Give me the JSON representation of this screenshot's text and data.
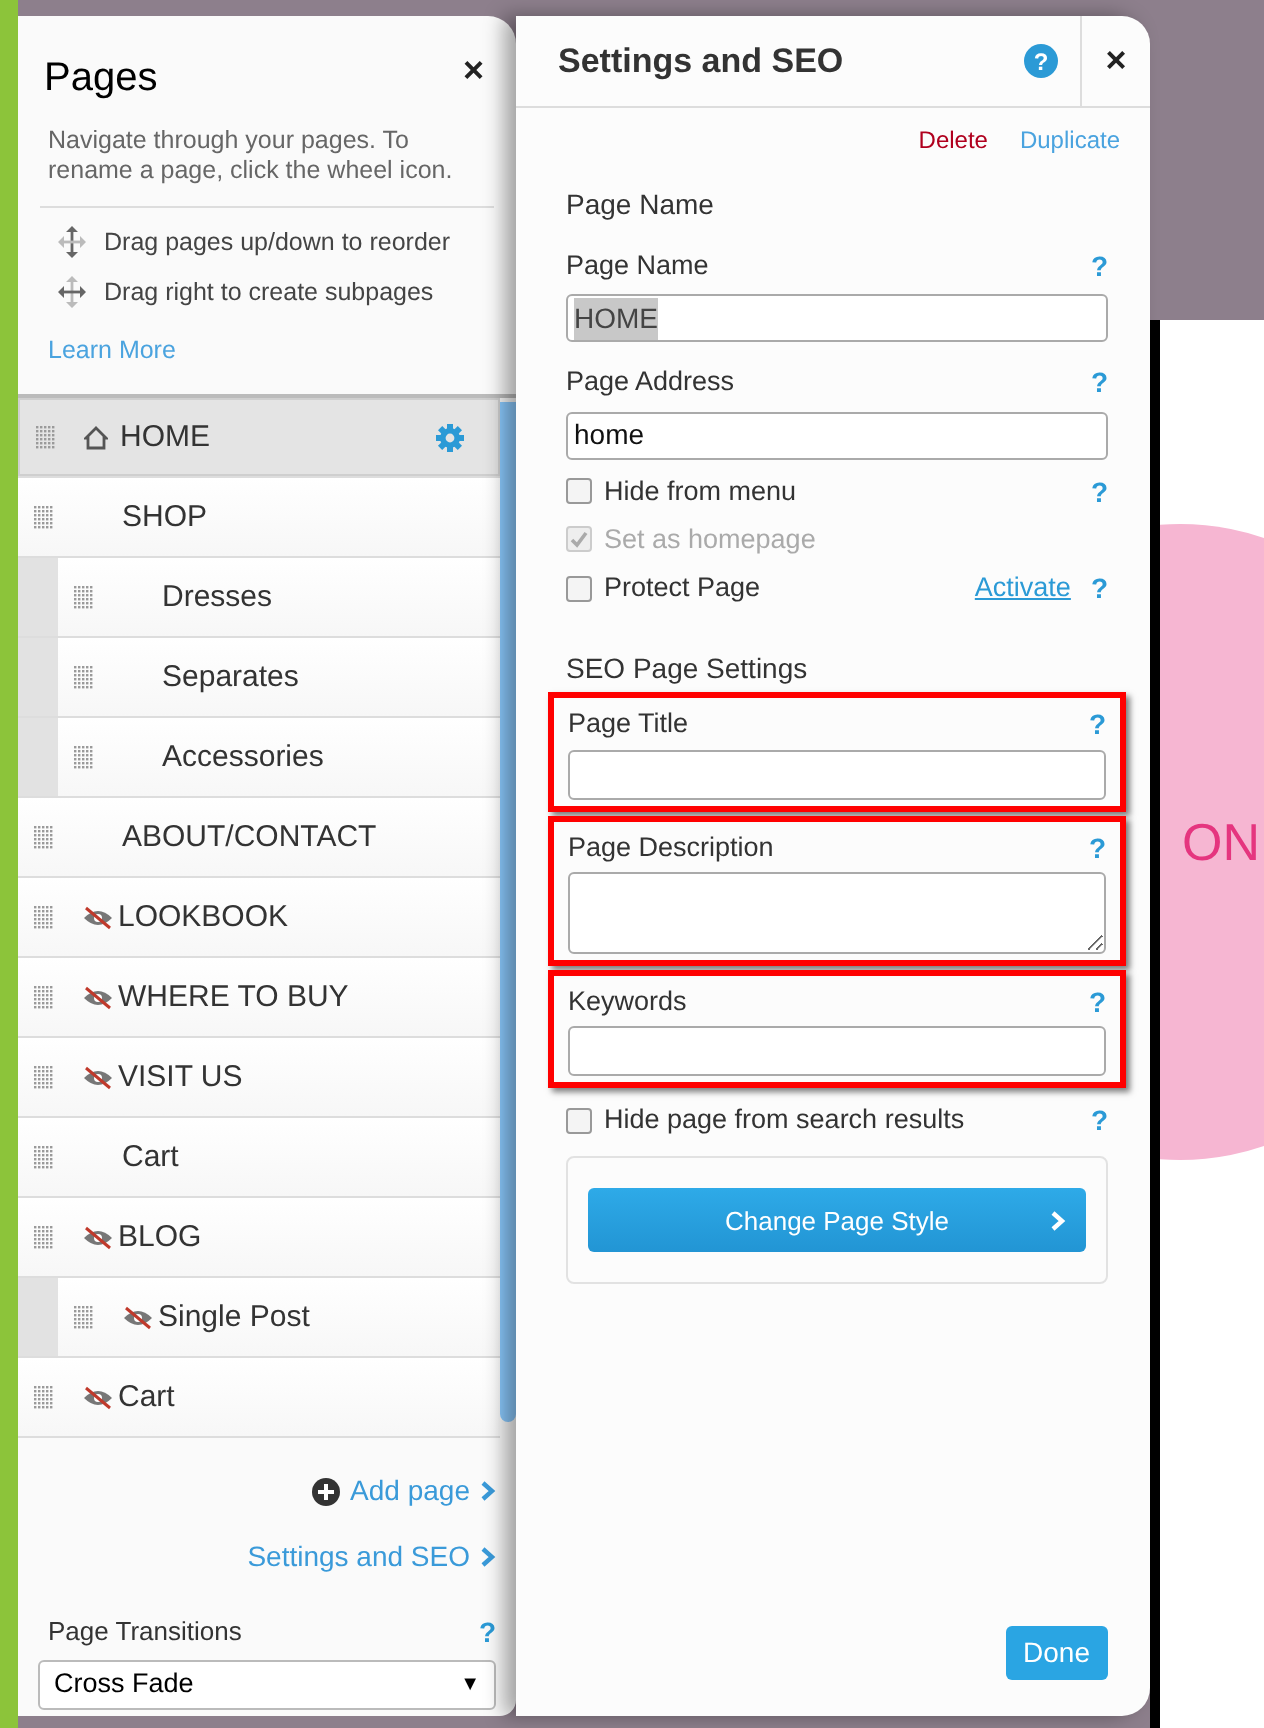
{
  "pages_panel": {
    "title": "Pages",
    "close": "×",
    "description": "Navigate through your pages. To rename a page, click the wheel icon.",
    "tips": [
      {
        "kind": "vertical",
        "text": "Drag pages up/down to reorder"
      },
      {
        "kind": "horizontal",
        "text": "Drag right to create subpages"
      }
    ],
    "learn_more": "Learn More",
    "pages": [
      {
        "name": "HOME",
        "home": true,
        "hidden": false,
        "selected": true
      },
      {
        "name": "SHOP",
        "home": false,
        "hidden": false,
        "selected": false,
        "children": [
          {
            "name": "Dresses",
            "home": false,
            "hidden": false,
            "selected": false
          },
          {
            "name": "Separates",
            "home": false,
            "hidden": false,
            "selected": false
          },
          {
            "name": "Accessories",
            "home": false,
            "hidden": false,
            "selected": false
          }
        ]
      },
      {
        "name": "ABOUT/CONTACT",
        "home": false,
        "hidden": false,
        "selected": false
      },
      {
        "name": "LOOKBOOK",
        "home": false,
        "hidden": true,
        "selected": false
      },
      {
        "name": "WHERE TO BUY",
        "home": false,
        "hidden": true,
        "selected": false
      },
      {
        "name": "VISIT US",
        "home": false,
        "hidden": true,
        "selected": false
      },
      {
        "name": "Cart",
        "home": false,
        "hidden": false,
        "selected": false
      },
      {
        "name": "BLOG",
        "home": false,
        "hidden": true,
        "selected": false,
        "children": [
          {
            "name": "Single Post",
            "home": false,
            "hidden": true,
            "selected": false
          }
        ]
      },
      {
        "name": "Cart",
        "home": false,
        "hidden": true,
        "selected": false
      }
    ],
    "add_page": "Add page",
    "settings_link": "Settings and SEO",
    "transitions": {
      "label": "Page Transitions",
      "help": "?",
      "value": "Cross Fade",
      "caret": "▼"
    }
  },
  "settings_panel": {
    "title": "Settings and SEO",
    "help": "?",
    "close": "×",
    "delete": "Delete",
    "duplicate": "Duplicate",
    "section": "Page Name",
    "fields": [
      {
        "label": "Page Name",
        "help": "?",
        "value": "HOME",
        "text_selected": true
      },
      {
        "label": "Page Address",
        "help": "?",
        "value": "home",
        "text_selected": false
      }
    ],
    "options": [
      {
        "label": "Hide from menu",
        "checked": false,
        "disabled": false,
        "help": "?"
      },
      {
        "label": "Set as homepage",
        "checked": true,
        "disabled": true
      },
      {
        "label": "Protect Page",
        "checked": false,
        "disabled": false,
        "link": "Activate",
        "help": "?"
      }
    ],
    "seo_section": "SEO Page Settings",
    "seo_fields": [
      {
        "label": "Page Title",
        "help": "?",
        "kind": "input",
        "highlighted": true
      },
      {
        "label": "Page Description",
        "help": "?",
        "kind": "textarea",
        "highlighted": true
      },
      {
        "label": "Keywords",
        "help": "?",
        "kind": "input",
        "highlighted": true
      }
    ],
    "seo_option": {
      "label": "Hide page from search results",
      "checked": false,
      "help": "?"
    },
    "style_button": "Change Page Style",
    "done": "Done"
  },
  "canvas": {
    "text": "ON"
  }
}
